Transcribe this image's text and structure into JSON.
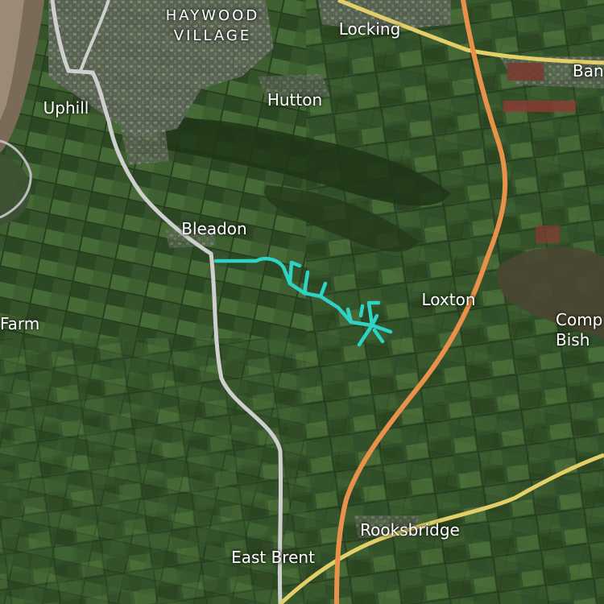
{
  "map": {
    "colors": {
      "motorway": "#e8914a",
      "primary_road": "#e3cf6a",
      "secondary_road": "#cfcfcf",
      "route": "#2fd3c6",
      "water": "#7a6a58"
    },
    "labels": {
      "haywood_line1": "HAYWOOD",
      "haywood_line2": "VILLAGE",
      "locking": "Locking",
      "banwell": "Ban",
      "uphill": "Uphill",
      "hutton": "Hutton",
      "bleadon": "Bleadon",
      "loxton": "Loxton",
      "farm": "Farm",
      "compton_line1": "Comp",
      "compton_line2": "Bish",
      "rooksbridge": "Rooksbridge",
      "east_brent": "East Brent"
    }
  }
}
